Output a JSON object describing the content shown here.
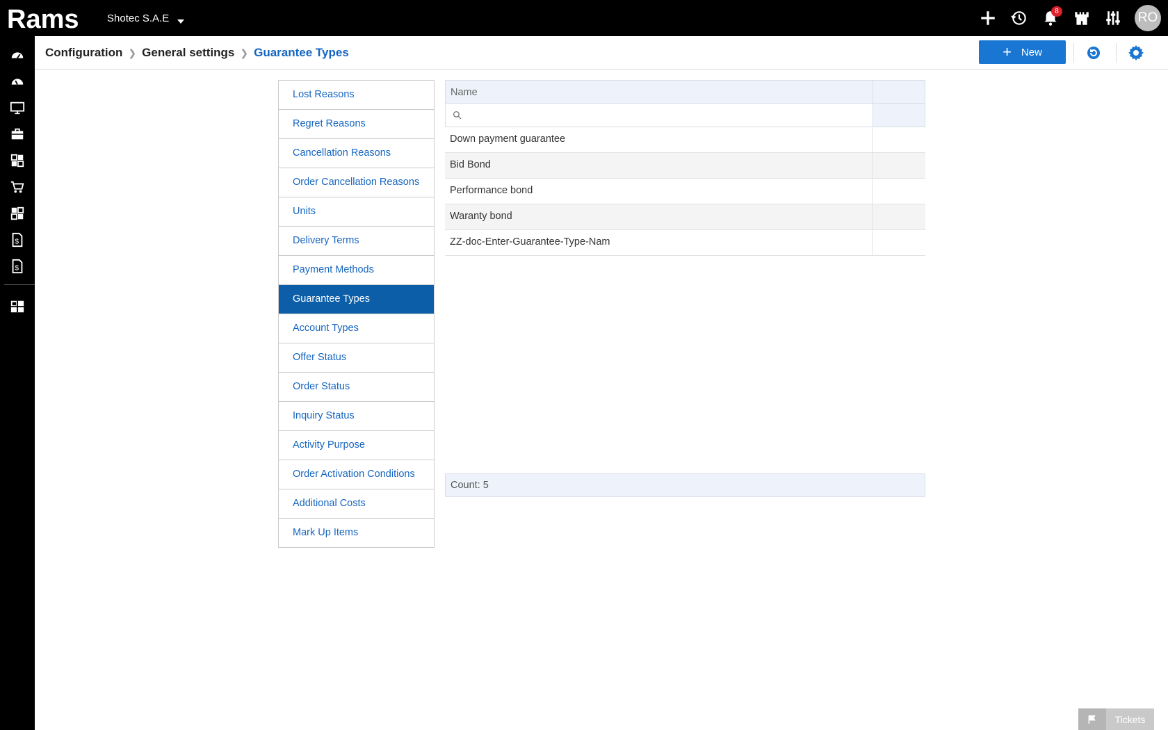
{
  "app": {
    "logo_text": "Rams",
    "company": "Shotec S.A.E"
  },
  "topbar": {
    "icons": [
      "plus-icon",
      "history-icon",
      "bell-icon",
      "castle-icon",
      "sliders-icon"
    ],
    "notification_count": "8",
    "avatar_initials": "RO"
  },
  "rail": {
    "icons": [
      "dashboard-icon",
      "dashboard-alt-icon",
      "monitor-icon",
      "briefcase-icon",
      "modules-icon",
      "cart-icon",
      "modules-alt-icon",
      "invoice-icon",
      "invoice-alt-icon",
      "report-icon"
    ]
  },
  "breadcrumb": {
    "items": [
      "Configuration",
      "General settings",
      "Guarantee Types"
    ]
  },
  "toolbar": {
    "new_label": "New"
  },
  "menu": {
    "items": [
      "Lost Reasons",
      "Regret Reasons",
      "Cancellation Reasons",
      "Order Cancellation Reasons",
      "Units",
      "Delivery Terms",
      "Payment Methods",
      "Guarantee Types",
      "Account Types",
      "Offer Status",
      "Order Status",
      "Inquiry Status",
      "Activity Purpose",
      "Order Activation Conditions",
      "Additional Costs",
      "Mark Up Items"
    ],
    "active": "Guarantee Types"
  },
  "grid": {
    "column_name": "Name",
    "filter_placeholder": "",
    "rows": [
      "Down payment guarantee",
      "Bid Bond",
      "Performance bond",
      "Waranty bond",
      "ZZ-doc-Enter-Guarantee-Type-Nam"
    ],
    "count_label": "Count: 5"
  },
  "tickets": {
    "label": "Tickets"
  },
  "colors": {
    "accent": "#1976d2",
    "active_menu": "#0d5ea8",
    "link": "#1565c0",
    "badge": "#e0202b"
  }
}
